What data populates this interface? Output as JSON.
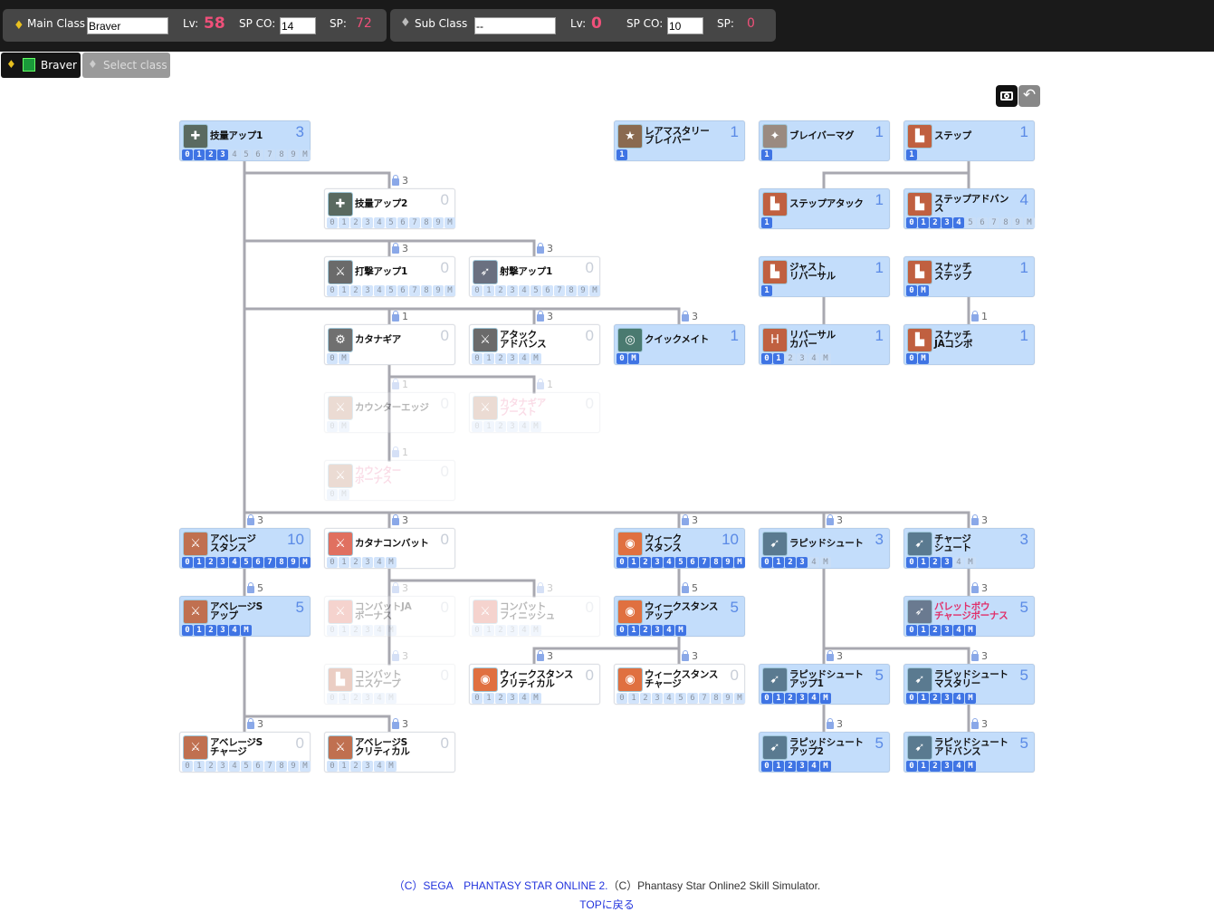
{
  "header": {
    "main_label": "Main Class",
    "main_value": "Braver",
    "main_lv_label": "Lv:",
    "main_lv": "58",
    "main_spco_label": "SP CO:",
    "main_spco": "14",
    "main_sp_label": "SP:",
    "main_sp": "72",
    "sub_label": "Sub  Class",
    "sub_value": "--",
    "sub_lv_label": "Lv:",
    "sub_lv": "0",
    "sub_spco_label": "SP CO:",
    "sub_spco": "10",
    "sub_sp_label": "SP:",
    "sub_sp": "0"
  },
  "tabs": [
    {
      "label": "Braver",
      "active": true
    },
    {
      "label": "Select class",
      "active": false
    }
  ],
  "toolbar": {
    "screenshot_icon": "camera-icon",
    "back_icon": "undo-arrow-icon"
  },
  "colors": {
    "active_node": "#c3ddfb",
    "level_filled": "#3f74e4",
    "level_text": "#5a8ae6",
    "lv_pink": "#f0507a",
    "pink_name": "#f08cb0",
    "red_name": "#e0306a",
    "connector": "#a8a8b0"
  },
  "nodes": [
    {
      "name": [
        "技量アップ1"
      ],
      "level": 3,
      "boxes": [
        "0",
        "1",
        "2",
        "3",
        "4",
        "5",
        "6",
        "7",
        "8",
        "9",
        "M"
      ],
      "state": "active",
      "icon": "technique-icon"
    },
    {
      "name": [
        "技量アップ2"
      ],
      "level": 0,
      "boxes": [
        "0",
        "1",
        "2",
        "3",
        "4",
        "5",
        "6",
        "7",
        "8",
        "9",
        "M"
      ],
      "state": "inactive",
      "icon": "technique-icon",
      "lock": "3"
    },
    {
      "name": [
        "打撃アップ1"
      ],
      "level": 0,
      "boxes": [
        "0",
        "1",
        "2",
        "3",
        "4",
        "5",
        "6",
        "7",
        "8",
        "9",
        "M"
      ],
      "state": "inactive",
      "icon": "sword-icon",
      "lock": "3"
    },
    {
      "name": [
        "射撃アップ1"
      ],
      "level": 0,
      "boxes": [
        "0",
        "1",
        "2",
        "3",
        "4",
        "5",
        "6",
        "7",
        "8",
        "9",
        "M"
      ],
      "state": "inactive",
      "icon": "bow-icon",
      "lock": "3"
    },
    {
      "name": [
        "カタナギア"
      ],
      "level": 0,
      "boxes": [
        "0",
        "M"
      ],
      "state": "inactive",
      "icon": "katana-gear-icon",
      "lock": "1"
    },
    {
      "name": [
        "アタック",
        "アドバンス"
      ],
      "level": 0,
      "boxes": [
        "0",
        "1",
        "2",
        "3",
        "4",
        "M"
      ],
      "state": "inactive",
      "icon": "sword-icon",
      "lock": "3"
    },
    {
      "name": [
        "クイックメイト"
      ],
      "level": 1,
      "boxes": [
        "0",
        "M"
      ],
      "state": "active",
      "icon": "mate-icon",
      "lock": "3"
    },
    {
      "name": [
        "カウンターエッジ"
      ],
      "level": 0,
      "boxes": [
        "0",
        "M"
      ],
      "state": "disabled",
      "icon": "katana-icon",
      "lock": "1"
    },
    {
      "name": [
        "カタナギア",
        "ブースト"
      ],
      "level": 0,
      "boxes": [
        "0",
        "1",
        "2",
        "3",
        "4",
        "M"
      ],
      "state": "disabled",
      "icon": "katana-icon",
      "lock": "1",
      "color": "pink"
    },
    {
      "name": [
        "カウンター",
        "ボーナス"
      ],
      "level": 0,
      "boxes": [
        "0",
        "M"
      ],
      "state": "disabled",
      "icon": "katana-icon",
      "lock": "1",
      "color": "pink"
    },
    {
      "name": [
        "レアマスタリー",
        "ブレイバー"
      ],
      "level": 1,
      "boxes": [
        "1"
      ],
      "state": "active",
      "icon": "rare-mastery-icon"
    },
    {
      "name": [
        "ブレイバーマグ"
      ],
      "level": 1,
      "boxes": [
        "1"
      ],
      "state": "active",
      "icon": "mag-icon"
    },
    {
      "name": [
        "ステップ"
      ],
      "level": 1,
      "boxes": [
        "1"
      ],
      "state": "active",
      "icon": "boots-icon"
    },
    {
      "name": [
        "ステップアタック"
      ],
      "level": 1,
      "boxes": [
        "1"
      ],
      "state": "active",
      "icon": "boots-icon"
    },
    {
      "name": [
        "ステップアドバンス"
      ],
      "level": 4,
      "boxes": [
        "0",
        "1",
        "2",
        "3",
        "4",
        "5",
        "6",
        "7",
        "8",
        "9",
        "M"
      ],
      "state": "active",
      "icon": "boots-icon"
    },
    {
      "name": [
        "ジャスト",
        "リバーサル"
      ],
      "level": 1,
      "boxes": [
        "1"
      ],
      "state": "active",
      "icon": "boots-icon"
    },
    {
      "name": [
        "スナッチ",
        "ステップ"
      ],
      "level": 1,
      "boxes": [
        "0",
        "M"
      ],
      "state": "active",
      "icon": "boots-icon"
    },
    {
      "name": [
        "リバーサル",
        "カバー"
      ],
      "level": 1,
      "boxes": [
        "0",
        "1",
        "2",
        "3",
        "4",
        "M"
      ],
      "state": "active",
      "icon": "hp-boots-icon"
    },
    {
      "name": [
        "スナッチ",
        "JAコンボ"
      ],
      "level": 1,
      "boxes": [
        "0",
        "M"
      ],
      "state": "active",
      "icon": "boots-icon",
      "lock": "1"
    },
    {
      "name": [
        "アベレージ",
        "スタンス"
      ],
      "level": 10,
      "boxes": [
        "0",
        "1",
        "2",
        "3",
        "4",
        "5",
        "6",
        "7",
        "8",
        "9",
        "M"
      ],
      "state": "active",
      "icon": "stance-icon",
      "lock": "3"
    },
    {
      "name": [
        "カタナコンバット"
      ],
      "level": 0,
      "boxes": [
        "0",
        "1",
        "2",
        "3",
        "4",
        "M"
      ],
      "state": "inactive",
      "icon": "katana-combat-icon",
      "lock": "3"
    },
    {
      "name": [
        "ウィーク",
        "スタンス"
      ],
      "level": 10,
      "boxes": [
        "0",
        "1",
        "2",
        "3",
        "4",
        "5",
        "6",
        "7",
        "8",
        "9",
        "M"
      ],
      "state": "active",
      "icon": "weak-stance-icon",
      "lock": "3"
    },
    {
      "name": [
        "ラピッドシュート"
      ],
      "level": 3,
      "boxes": [
        "0",
        "1",
        "2",
        "3",
        "4",
        "M"
      ],
      "state": "active",
      "icon": "arrows-icon",
      "lock": "3"
    },
    {
      "name": [
        "チャージ",
        "シュート"
      ],
      "level": 3,
      "boxes": [
        "0",
        "1",
        "2",
        "3",
        "4",
        "M"
      ],
      "state": "active",
      "icon": "arrows-icon",
      "lock": "3"
    },
    {
      "name": [
        "アベレージS",
        "アップ"
      ],
      "level": 5,
      "boxes": [
        "0",
        "1",
        "2",
        "3",
        "4",
        "M"
      ],
      "state": "active",
      "icon": "stance-icon",
      "lock": "5"
    },
    {
      "name": [
        "コンバットJA",
        "ボーナス"
      ],
      "level": 0,
      "boxes": [
        "0",
        "1",
        "2",
        "3",
        "4",
        "M"
      ],
      "state": "disabled",
      "icon": "katana-combat-icon",
      "lock": "3"
    },
    {
      "name": [
        "コンバット",
        "フィニッシュ"
      ],
      "level": 0,
      "boxes": [
        "0",
        "1",
        "2",
        "3",
        "4",
        "M"
      ],
      "state": "disabled",
      "icon": "katana-combat-icon",
      "lock": "3"
    },
    {
      "name": [
        "ウィークスタンス",
        "アップ"
      ],
      "level": 5,
      "boxes": [
        "0",
        "1",
        "2",
        "3",
        "4",
        "M"
      ],
      "state": "active",
      "icon": "weak-stance-icon",
      "lock": "5"
    },
    {
      "name": [
        "バレットボウ",
        "チャージボーナス"
      ],
      "level": 5,
      "boxes": [
        "0",
        "1",
        "2",
        "3",
        "4",
        "M"
      ],
      "state": "active",
      "icon": "bow-pp-icon",
      "lock": "3",
      "color": "red"
    },
    {
      "name": [
        "コンバット",
        "エスケープ"
      ],
      "level": 0,
      "boxes": [
        "0",
        "1",
        "2",
        "3",
        "4",
        "M"
      ],
      "state": "disabled",
      "icon": "boots-icon",
      "lock": "3"
    },
    {
      "name": [
        "ウィークスタンス",
        "クリティカル"
      ],
      "level": 0,
      "boxes": [
        "0",
        "1",
        "2",
        "3",
        "4",
        "M"
      ],
      "state": "inactive",
      "icon": "weak-stance-icon",
      "lock": "3"
    },
    {
      "name": [
        "ウィークスタンス",
        "チャージ"
      ],
      "level": 0,
      "boxes": [
        "0",
        "1",
        "2",
        "3",
        "4",
        "5",
        "6",
        "7",
        "8",
        "9",
        "M"
      ],
      "state": "inactive",
      "icon": "weak-stance-icon",
      "lock": "3"
    },
    {
      "name": [
        "ラピッドシュート",
        "アップ1"
      ],
      "level": 5,
      "boxes": [
        "0",
        "1",
        "2",
        "3",
        "4",
        "M"
      ],
      "state": "active",
      "icon": "arrows-icon",
      "lock": "3"
    },
    {
      "name": [
        "ラピッドシュート",
        "マスタリー"
      ],
      "level": 5,
      "boxes": [
        "0",
        "1",
        "2",
        "3",
        "4",
        "M"
      ],
      "state": "active",
      "icon": "arrows-icon",
      "lock": "3"
    },
    {
      "name": [
        "アベレージS",
        "チャージ"
      ],
      "level": 0,
      "boxes": [
        "0",
        "1",
        "2",
        "3",
        "4",
        "5",
        "6",
        "7",
        "8",
        "9",
        "M"
      ],
      "state": "inactive",
      "icon": "stance-icon",
      "lock": "3"
    },
    {
      "name": [
        "アベレージS",
        "クリティカル"
      ],
      "level": 0,
      "boxes": [
        "0",
        "1",
        "2",
        "3",
        "4",
        "M"
      ],
      "state": "inactive",
      "icon": "stance-icon",
      "lock": "3"
    },
    {
      "name": [
        "ラピッドシュート",
        "アップ2"
      ],
      "level": 5,
      "boxes": [
        "0",
        "1",
        "2",
        "3",
        "4",
        "M"
      ],
      "state": "active",
      "icon": "arrows-icon",
      "lock": "3"
    },
    {
      "name": [
        "ラピッドシュート",
        "アドバンス"
      ],
      "level": 5,
      "boxes": [
        "0",
        "1",
        "2",
        "3",
        "4",
        "M"
      ],
      "state": "active",
      "icon": "arrows-icon",
      "lock": "3"
    }
  ],
  "footer": {
    "copyright_sega": "（C）SEGA　PHANTASY STAR ONLINE 2.",
    "copyright_sim": "（C）Phantasy Star Online2 Skill Simulator.",
    "top_link": "TOPに戻る"
  }
}
